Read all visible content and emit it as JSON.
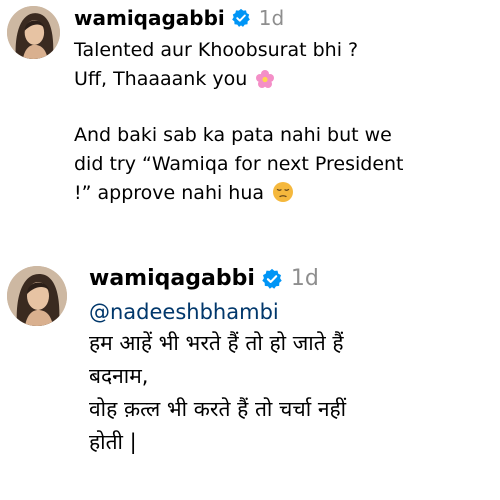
{
  "comments": [
    {
      "username": "wamiqagabbi",
      "time": "1d",
      "lines": [
        "Talented aur Khoobsurat bhi ?",
        "Uff, Thaaaank you",
        "",
        "And baki sab ka pata nahi but we",
        "did try “Wamiqa for next President",
        "!” approve nahi hua"
      ],
      "emoji_line2": "cherry-blossom",
      "emoji_line6": "pensive-face"
    },
    {
      "username": "wamiqagabbi",
      "time": "1d",
      "mention": "@nadeeshbhambi",
      "lines": [
        "हम आहें भी भरते हैं तो हो जाते हैं",
        "बदनाम,",
        "वोह क़त्ल भी करते हैं तो चर्चा नहीं",
        "होती |"
      ]
    }
  ],
  "colors": {
    "verified": "#0095f6",
    "time": "#8e8e8e",
    "mention": "#00376b",
    "blossom": "#f48fc7"
  }
}
